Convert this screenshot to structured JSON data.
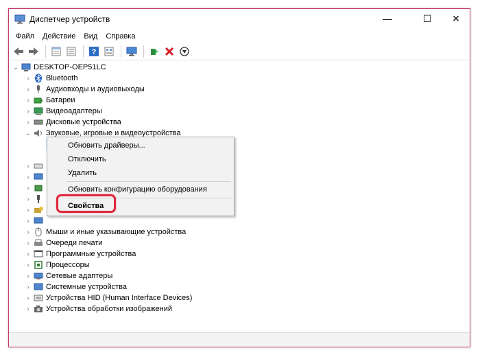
{
  "window": {
    "title": "Диспетчер устройств",
    "minimize": "—",
    "maximize": "☐",
    "close": "✕"
  },
  "menu": [
    "Файл",
    "Действие",
    "Вид",
    "Справка"
  ],
  "tree": {
    "root": "DESKTOP-OEP51LC",
    "items": [
      "Bluetooth",
      "Аудиовходы и аудиовыходы",
      "Батареи",
      "Видеоадаптеры",
      "Дисковые устройства",
      "Звуковые, игровые и видеоустройства",
      "Мыши и иные указывающие устройства",
      "Очереди печати",
      "Программные устройства",
      "Процессоры",
      "Сетевые адаптеры",
      "Системные устройства",
      "Устройства HID (Human Interface Devices)",
      "Устройства обработки изображений"
    ]
  },
  "context_menu": {
    "update_drivers": "Обновить драйверы...",
    "disable": "Отключить",
    "uninstall": "Удалить",
    "scan_hardware": "Обновить конфигурацию оборудования",
    "properties": "Свойства"
  },
  "colors": {
    "accent_border": "#c23a6b",
    "highlight": "#e0263a"
  }
}
